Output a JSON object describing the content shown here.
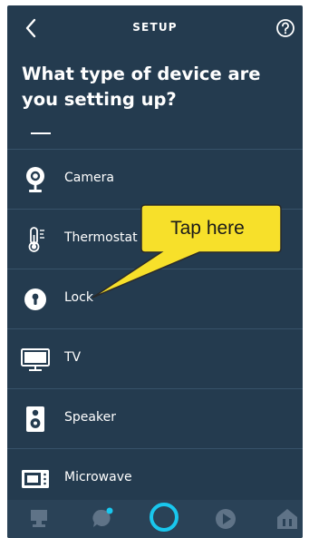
{
  "header": {
    "title": "SETUP",
    "back_icon": "chevron-left-icon",
    "help_icon": "question-circle-icon"
  },
  "question": "What type of device are you setting up?",
  "devices": [
    {
      "label": "Camera",
      "icon": "camera-icon"
    },
    {
      "label": "Thermostat",
      "icon": "thermostat-icon"
    },
    {
      "label": "Lock",
      "icon": "lock-icon"
    },
    {
      "label": "TV",
      "icon": "tv-icon"
    },
    {
      "label": "Speaker",
      "icon": "speaker-icon"
    },
    {
      "label": "Microwave",
      "icon": "microwave-icon"
    }
  ],
  "callout": {
    "text": "Tap here"
  },
  "nav": [
    "home-icon",
    "communicate-icon",
    "alexa-icon",
    "play-icon",
    "devices-icon"
  ],
  "colors": {
    "background": "#243b4f",
    "accent": "#19c7ee",
    "callout": "#f7e02a"
  }
}
